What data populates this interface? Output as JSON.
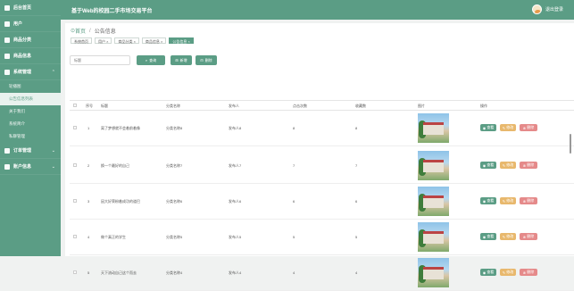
{
  "header": {
    "title": "基于Web的校园二手市场交易平台",
    "logout": "退出登录"
  },
  "sidebar": {
    "items": [
      {
        "label": "后台首页"
      },
      {
        "label": "用户"
      },
      {
        "label": "商品分类"
      },
      {
        "label": "商品信息"
      },
      {
        "label": "系统管理",
        "expanded": true
      },
      {
        "label": "订单管理"
      },
      {
        "label": "账户信息"
      }
    ],
    "sub": [
      {
        "label": "轮播图"
      },
      {
        "label": "公告信息列表"
      },
      {
        "label": "关于我们"
      },
      {
        "label": "系统简介"
      },
      {
        "label": "私聊管理"
      }
    ]
  },
  "breadcrumb": {
    "home": "首页",
    "current": "公告信息"
  },
  "tags": [
    "系统首页",
    "用户 ×",
    "商品分类 ×",
    "商品信息 ×",
    "公告信息 ×"
  ],
  "search": {
    "placeholder": "标题",
    "search_label": "查询",
    "add_label": "新增",
    "delete_label": "删除"
  },
  "table": {
    "headers": [
      "序号",
      "标题",
      "分类名称",
      "发布人",
      "点击次数",
      "收藏数",
      "图片",
      "操作"
    ],
    "rows": [
      {
        "no": "1",
        "title": "离了梦想就不会着前着像",
        "category": "分类名称8",
        "publisher": "发布人8",
        "clicks": "8",
        "favs": "8"
      },
      {
        "no": "2",
        "title": "换一个最好的自己",
        "category": "分类名称7",
        "publisher": "发布人7",
        "clicks": "7",
        "favs": "7"
      },
      {
        "no": "3",
        "title": "因大好荣粉着成功的道巴",
        "category": "分类名称6",
        "publisher": "发布人6",
        "clicks": "6",
        "favs": "6"
      },
      {
        "no": "4",
        "title": "做个真正的学生",
        "category": "分类名称5",
        "publisher": "发布人5",
        "clicks": "5",
        "favs": "5"
      },
      {
        "no": "5",
        "title": "天下流动自己这个而去",
        "category": "分类名称4",
        "publisher": "发布人4",
        "clicks": "4",
        "favs": "4"
      }
    ],
    "actions": {
      "view": "查看",
      "edit": "修改",
      "delete": "删除"
    }
  },
  "colors": {
    "accent": "#5b9d85",
    "edit": "#e8b86d",
    "delete": "#e58a8a"
  }
}
